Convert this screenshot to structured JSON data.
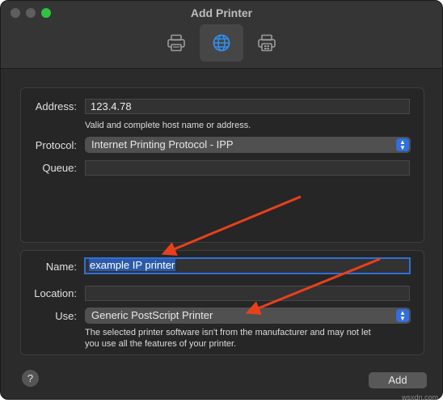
{
  "window": {
    "title": "Add Printer",
    "accent_color": "#2f6fe0",
    "toolbar": [
      {
        "icon": "printer-icon",
        "selected": false
      },
      {
        "icon": "globe-icon",
        "selected": true
      },
      {
        "icon": "windows-printer-icon",
        "selected": false
      }
    ]
  },
  "connection": {
    "address_label": "Address:",
    "address_value": "123.4.78",
    "address_hint": "Valid and complete host name or address.",
    "protocol_label": "Protocol:",
    "protocol_value": "Internet Printing Protocol - IPP",
    "queue_label": "Queue:",
    "queue_value": ""
  },
  "details": {
    "name_label": "Name:",
    "name_value": "example IP printer",
    "location_label": "Location:",
    "location_value": "",
    "use_label": "Use:",
    "use_value": "Generic PostScript Printer",
    "use_hint_line1": "The selected printer software isn't from the manufacturer and may not let",
    "use_hint_line2": "you use all the features of your printer."
  },
  "footer": {
    "help_label": "?",
    "add_label": "Add"
  },
  "annotation_color": "#e8401c",
  "watermark": "wsxdn.com"
}
